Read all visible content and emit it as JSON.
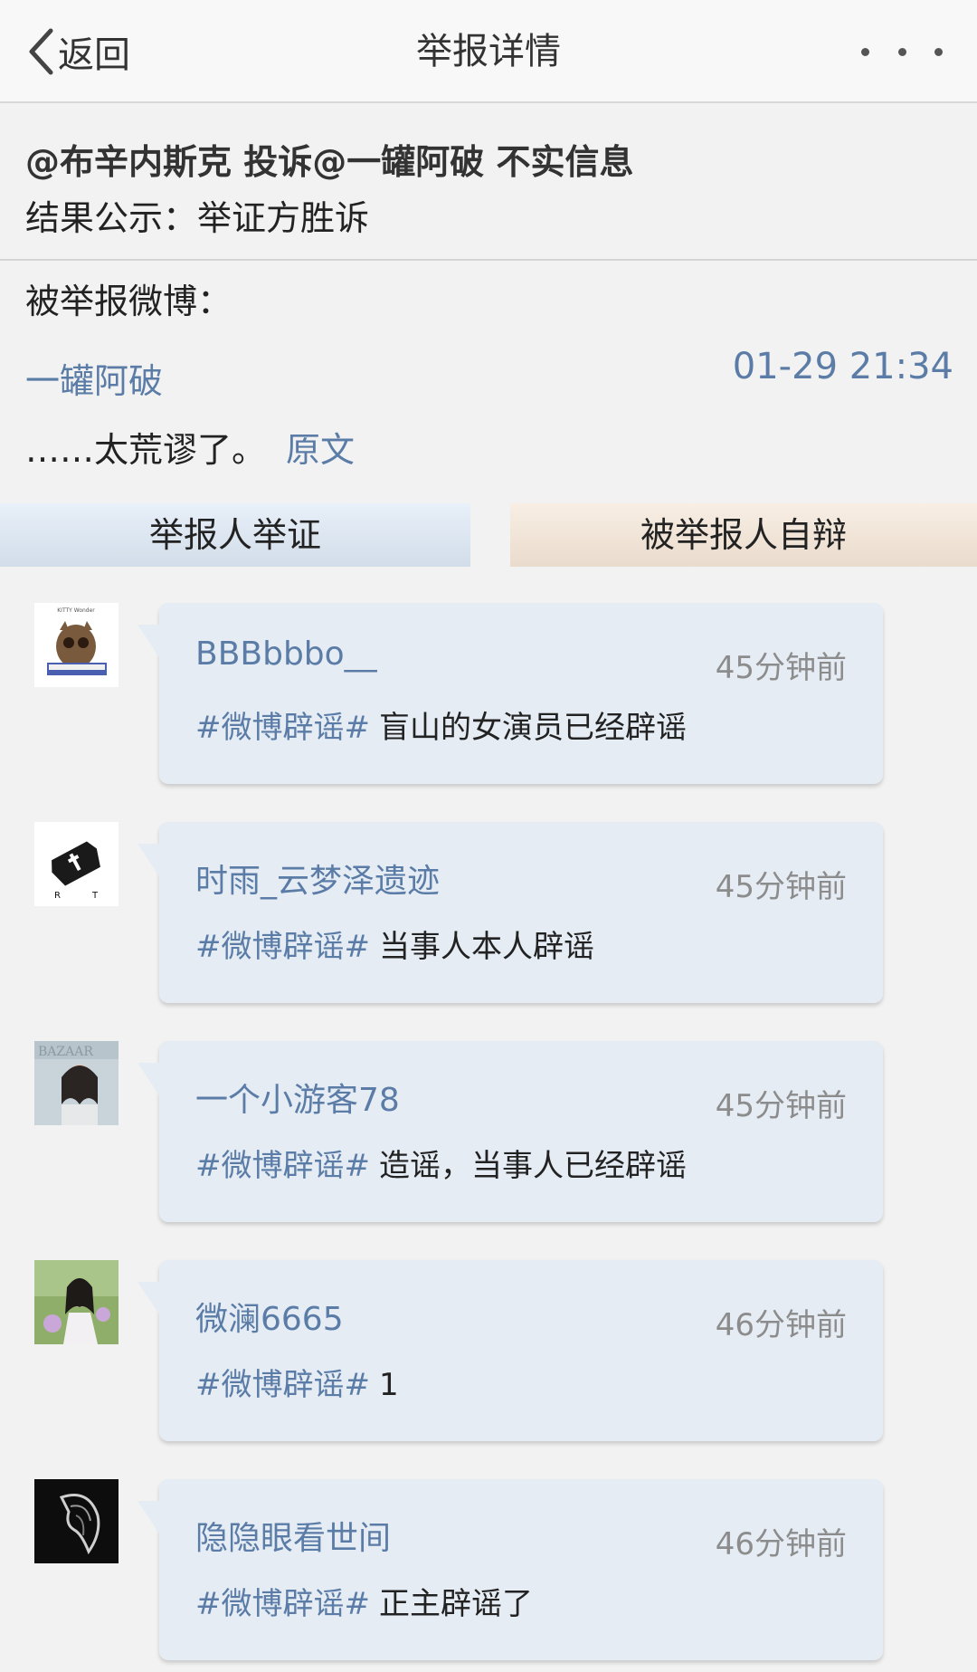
{
  "navbar": {
    "back_label": "返回",
    "title": "举报详情"
  },
  "case": {
    "title": "@布辛内斯克 投诉@一罐阿破 不实信息",
    "result": "结果公示：举证方胜诉"
  },
  "reported": {
    "label": "被举报微博：",
    "user": "一罐阿破",
    "time": "01-29 21:34",
    "text": "……太荒谬了。",
    "link_label": "原文"
  },
  "tabs": [
    {
      "label": "举报人举证"
    },
    {
      "label": "被举报人自辩"
    }
  ],
  "entries": [
    {
      "user": "BBBbbbo__",
      "time": "45分钟前",
      "tag": "#微博辟谣#",
      "text": "盲山的女演员已经辟谣"
    },
    {
      "user": "时雨_云梦泽遗迹",
      "time": "45分钟前",
      "tag": "#微博辟谣#",
      "text": "当事人本人辟谣"
    },
    {
      "user": "一个小游客78",
      "time": "45分钟前",
      "tag": "#微博辟谣#",
      "text": "造谣，当事人已经辟谣"
    },
    {
      "user": "微澜6665",
      "time": "46分钟前",
      "tag": "#微博辟谣#",
      "text": "1"
    },
    {
      "user": "隐隐眼看世间",
      "time": "46分钟前",
      "tag": "#微博辟谣#",
      "text": "正主辟谣了"
    }
  ],
  "colors": {
    "link": "#5a7ca6",
    "bubble": "#e5ecf4",
    "tab_left": "#dbe5f0",
    "tab_right": "#f2e6da"
  },
  "icons": {
    "back": "chevron-left-icon",
    "more": "more-dots-icon"
  }
}
